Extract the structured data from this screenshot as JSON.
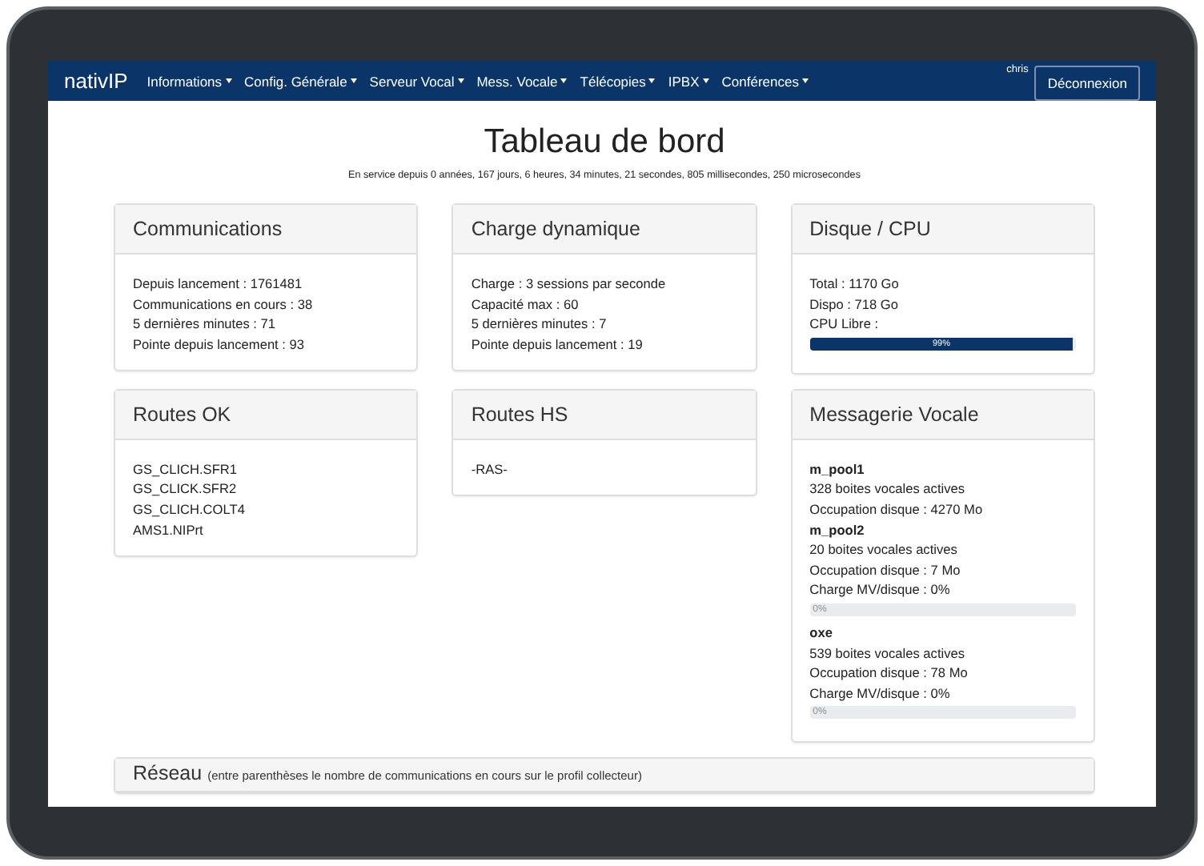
{
  "navbar": {
    "brand": "nativIP",
    "menu": [
      {
        "label": "Informations"
      },
      {
        "label": "Config. Générale"
      },
      {
        "label": "Serveur Vocal"
      },
      {
        "label": "Mess. Vocale"
      },
      {
        "label": "Télécopies"
      },
      {
        "label": "IPBX"
      },
      {
        "label": "Conférences"
      }
    ],
    "user": "chris",
    "logout": "Déconnexion"
  },
  "title": "Tableau de bord",
  "uptime": "En service depuis 0 années, 167 jours, 6 heures, 34 minutes, 21 secondes, 805 millisecondes, 250 microsecondes",
  "panels": [
    {
      "title": "Communications",
      "items": [
        {
          "kind": "text",
          "text": "Depuis lancement : 1761481"
        },
        {
          "kind": "text",
          "text": "Communications en cours : 38"
        },
        {
          "kind": "text",
          "text": "5 dernières minutes : 71"
        },
        {
          "kind": "text",
          "text": "Pointe depuis lancement : 93"
        }
      ]
    },
    {
      "title": "Charge dynamique",
      "items": [
        {
          "kind": "text",
          "text": "Charge : 3 sessions par seconde"
        },
        {
          "kind": "text",
          "text": "Capacité max : 60"
        },
        {
          "kind": "text",
          "text": "5 dernières minutes : 7"
        },
        {
          "kind": "text",
          "text": "Pointe depuis lancement : 19"
        }
      ]
    },
    {
      "title": "Disque / CPU",
      "items": [
        {
          "kind": "text",
          "text": "Total : 1170 Go"
        },
        {
          "kind": "text",
          "text": "Dispo : 718 Go"
        },
        {
          "kind": "text",
          "text": "CPU Libre :"
        },
        {
          "kind": "progress",
          "level": 0.99,
          "label": "99%"
        }
      ]
    },
    {
      "title": "Routes OK",
      "items": [
        {
          "kind": "text",
          "text": "GS_CLICH.SFR1"
        },
        {
          "kind": "text",
          "text": "GS_CLICK.SFR2"
        },
        {
          "kind": "text",
          "text": "GS_CLICH.COLT4"
        },
        {
          "kind": "text",
          "text": "AMS1.NIPrt"
        }
      ]
    },
    {
      "title": "Routes HS",
      "items": [
        {
          "kind": "text",
          "text": "-RAS-"
        }
      ]
    },
    {
      "title": "Messagerie Vocale",
      "items": [
        {
          "kind": "heading",
          "text": "m_pool1"
        },
        {
          "kind": "text",
          "text": "328 boites vocales actives"
        },
        {
          "kind": "text",
          "text": "Occupation disque : 4270 Mo"
        },
        {
          "kind": "heading",
          "text": "m_pool2"
        },
        {
          "kind": "text",
          "text": "20 boites vocales actives"
        },
        {
          "kind": "text",
          "text": "Occupation disque : 7 Mo"
        },
        {
          "kind": "text",
          "text": "Charge MV/disque : 0%"
        },
        {
          "kind": "progress",
          "level": 0,
          "label": "0%"
        },
        {
          "kind": "heading",
          "text": "oxe"
        },
        {
          "kind": "text",
          "text": "539 boites vocales actives"
        },
        {
          "kind": "text",
          "text": "Occupation disque : 78 Mo"
        },
        {
          "kind": "text",
          "text": "Charge MV/disque : 0%"
        },
        {
          "kind": "progress",
          "level": 0,
          "label": "0%"
        }
      ]
    }
  ],
  "network": {
    "title": "Réseau",
    "note": "(entre parenthèses le nombre de communications en cours sur le profil collecteur)"
  }
}
